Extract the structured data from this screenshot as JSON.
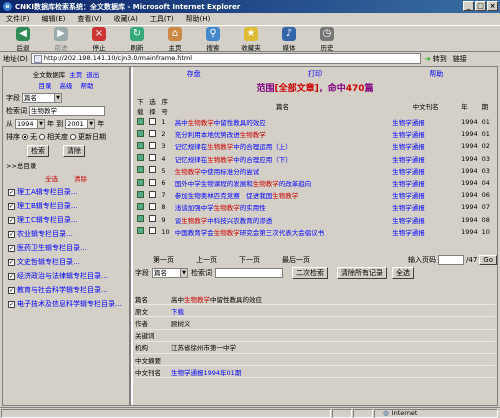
{
  "window": {
    "title": "CNKI数据库检索系统：全文数据库 - Microsoft Internet Explorer"
  },
  "menu": {
    "items": [
      "文件(F)",
      "编辑(E)",
      "查看(V)",
      "收藏(A)",
      "工具(T)",
      "帮助(H)"
    ]
  },
  "toolbar": {
    "buttons": [
      "后退",
      "前进",
      "停止",
      "刷新",
      "主页",
      "搜索",
      "收藏夹",
      "媒体",
      "历史"
    ]
  },
  "address": {
    "label": "地址(D)",
    "url": "http://202.198.141.10/cjn3.0/mainframe.html",
    "go": "转到",
    "links": "链接"
  },
  "left": {
    "nav1": [
      "全文数据库",
      "主页",
      "退出"
    ],
    "nav2": [
      "目录",
      "高级",
      "帮助"
    ],
    "field_label": "字段",
    "field_value": "篇名",
    "keyword_label": "检索词",
    "keyword_value": "生物教学",
    "from_label": "从",
    "year_from": "1994",
    "to_label": "年 到",
    "year_to": "2001",
    "year_suffix": "年",
    "sort_label": "排序",
    "sort_opts": [
      "无",
      "相关度",
      "更新日期"
    ],
    "search_btn": "检索",
    "clear_btn": "清除",
    "catalog_head": "总目录",
    "select_all": "全选",
    "clear_sel": "清除",
    "categories": [
      {
        "label": "理工A辑专栏目录",
        "checked": true
      },
      {
        "label": "理工B辑专栏目录",
        "checked": true
      },
      {
        "label": "理工C辑专栏目录",
        "checked": true
      },
      {
        "label": "农业辑专栏目录",
        "checked": true
      },
      {
        "label": "医药卫生辑专栏目录",
        "checked": true
      },
      {
        "label": "文史哲辑专栏目录",
        "checked": true
      },
      {
        "label": "经济政治与法律辑专栏目录",
        "checked": true
      },
      {
        "label": "教育与社会科学辑专栏目录",
        "checked": true
      },
      {
        "label": "电子技术及信息科学辑专栏目录",
        "checked": true
      }
    ]
  },
  "right": {
    "top_links": [
      "存盘",
      "打印",
      "帮助"
    ],
    "result_text": "范围[全部文章]，命中470篇",
    "headers": [
      "下载",
      "选择",
      "序号",
      "篇名",
      "中文刊名",
      "年",
      "期"
    ],
    "rows": [
      {
        "n": "1",
        "pre": "高中",
        "kw": "生物教学",
        "post": "中留性教具的效应",
        "j": "生物学通报",
        "y": "1994",
        "i": "01"
      },
      {
        "n": "2",
        "pre": "充分利用本地优势改进",
        "kw": "生物教学",
        "post": "",
        "j": "生物学通报",
        "y": "1994",
        "i": "01"
      },
      {
        "n": "3",
        "pre": "记忆规律在",
        "kw": "生物教学",
        "post": "中的合理运用（上）",
        "j": "生物学通报",
        "y": "1994",
        "i": "02"
      },
      {
        "n": "4",
        "pre": "记忆规律在",
        "kw": "生物教学",
        "post": "中的合理应用（下）",
        "j": "生物学通报",
        "y": "1994",
        "i": "03"
      },
      {
        "n": "5",
        "pre": "",
        "kw": "生物教学",
        "post": "中使用标准分的尝试",
        "j": "生物学通报",
        "y": "1994",
        "i": "03"
      },
      {
        "n": "6",
        "pre": "国外中学生物课程的发展和",
        "kw": "生物教学",
        "post": "的改革趋向",
        "j": "生物学通报",
        "y": "1994",
        "i": "04"
      },
      {
        "n": "7",
        "pre": "参加生物奥林匹克竞赛　促进我国",
        "kw": "生物教学",
        "post": "",
        "j": "生物学通报",
        "y": "1994",
        "i": "06"
      },
      {
        "n": "8",
        "pre": "浅谈加强中学",
        "kw": "生物教学",
        "post": "的实用性",
        "j": "生物学通报",
        "y": "1994",
        "i": "07"
      },
      {
        "n": "9",
        "pre": "谈",
        "kw": "生物教学",
        "post": "中科技兴农教育的渗透",
        "j": "生物学通报",
        "y": "1994",
        "i": "08"
      },
      {
        "n": "10",
        "pre": "中国教育学会",
        "kw": "生物教学",
        "post": "研究会第三次代表大会倡议书",
        "j": "生物学通报",
        "y": "1994",
        "i": "10"
      }
    ],
    "pager": {
      "first": "第一页",
      "prev": "上一页",
      "next": "下一页",
      "last": "最后一页",
      "input_label": "输入页码",
      "page_value": "",
      "total": "/47",
      "go": "Go"
    },
    "search2": {
      "field_label": "字段",
      "field_value": "篇名",
      "keyword_label": "检索词",
      "keyword_value": "",
      "second_btn": "二次检索",
      "clear_btn": "清除所有记录",
      "select_all": "全选"
    },
    "detail": {
      "rows": [
        {
          "k": "篇名",
          "pre": "高中",
          "kw": "生物教学",
          "post": "中留性教具的效应"
        },
        {
          "k": "原文",
          "pre": "",
          "kw": "",
          "post": "",
          "link": "下载"
        },
        {
          "k": "作者",
          "pre": "顾树义",
          "kw": "",
          "post": ""
        },
        {
          "k": "关键词",
          "pre": "",
          "kw": "",
          "post": ""
        },
        {
          "k": "机构",
          "pre": "江苏省徐州市第一中学",
          "kw": "",
          "post": ""
        },
        {
          "k": "中文摘要",
          "pre": "",
          "kw": "",
          "post": ""
        },
        {
          "k": "中文刊名",
          "pre": "",
          "kw": "",
          "post": "",
          "link": "生物学通报1994年01期"
        }
      ]
    }
  },
  "status": {
    "zone": "Internet"
  }
}
